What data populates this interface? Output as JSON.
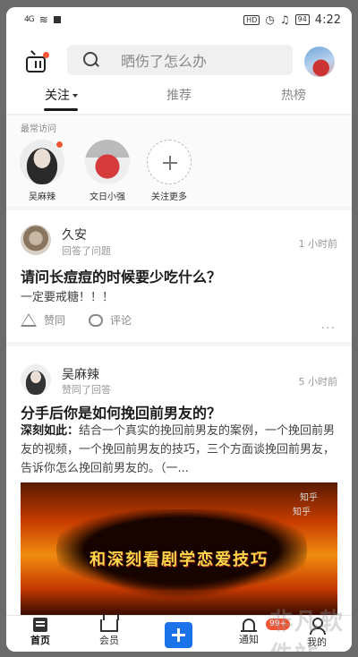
{
  "status_bar": {
    "signal": "4G",
    "hd": "HD",
    "battery": "94",
    "time": "4:22"
  },
  "header": {
    "search_placeholder": "晒伤了怎么办"
  },
  "tabs": [
    {
      "label": "关注"
    },
    {
      "label": "推荐"
    },
    {
      "label": "热榜"
    }
  ],
  "frequent": {
    "title": "最常访问",
    "items": [
      {
        "label": "吴麻辣"
      },
      {
        "label": "文日小强"
      },
      {
        "label": "关注更多"
      }
    ]
  },
  "feed": [
    {
      "name": "久安",
      "action": "回答了问题",
      "time": "1 小时前",
      "title": "请问长痘痘的时候要少吃什么？",
      "excerpt": "一定要戒糖！！！",
      "like_label": "赞同",
      "comment_label": "评论",
      "more": "···"
    },
    {
      "name": "吴麻辣",
      "action": "赞同了回答",
      "time": "5 小时前",
      "title": "分手后你是如何挽回前男友的？",
      "author_prefix": "深刻如此：",
      "excerpt": "结合一个真实的挽回前男友的案例，一个挽回前男友的视频，一个挽回前男友的技巧，三个方面谈挽回前男友，告诉你怎么挽回前男友的。（一...",
      "media_caption": "和深刻看剧学恋爱技巧",
      "media_watermark_1": "知乎",
      "media_watermark_2": "知乎"
    }
  ],
  "bottom_tabs": [
    {
      "label": "首页"
    },
    {
      "label": "会员"
    },
    {
      "label": "通知"
    },
    {
      "label": "我的"
    }
  ],
  "notification_badge": "99+",
  "watermark": "非凡软件站",
  "colors": {
    "accent_blue": "#1a73e8",
    "badge_red": "#f15533"
  }
}
